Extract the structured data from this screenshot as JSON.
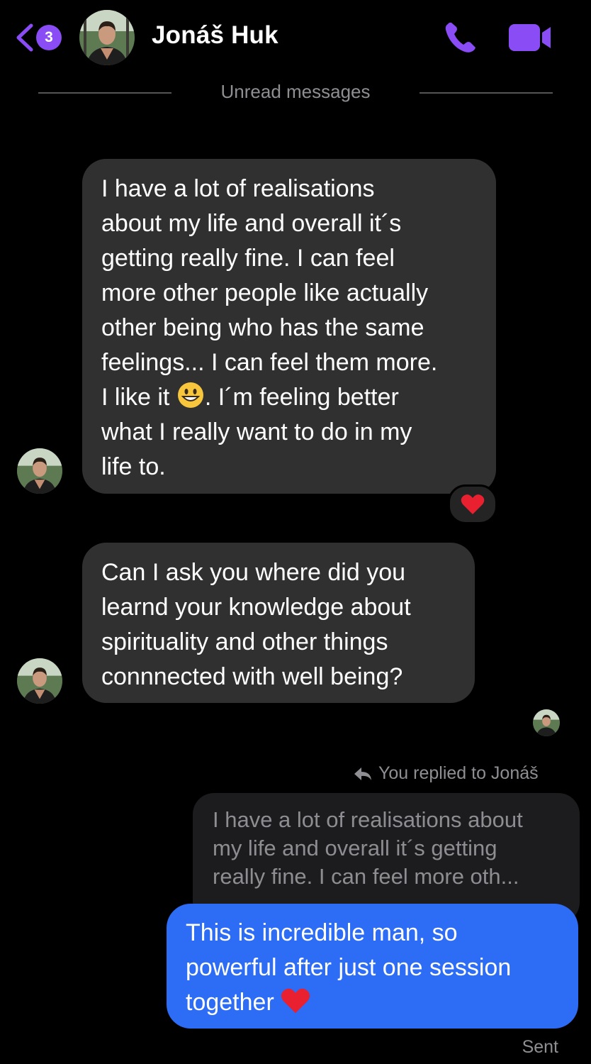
{
  "header": {
    "back_count": "3",
    "contact_name": "Jonáš Huk",
    "accent_color": "#8a4cf5"
  },
  "divider": {
    "label": "Unread messages"
  },
  "messages": {
    "first": {
      "text_before_emoji": "I have a lot of realisations\nabout my life and overall it´s\ngetting really fine. I can feel\nmore other people like actually\nother being who has the same\nfeelings... I can feel them more.\nI like it ",
      "text_after_emoji": ". I´m feeling better\nwhat I really want to do in my\nlife to.",
      "emoji": "grinning-face",
      "reaction": "red-heart"
    },
    "second": {
      "text": "Can I ask you where did you\nlearnd your knowledge about\nspirituality and other things\nconnnected with well being?"
    }
  },
  "reply": {
    "label": "You replied to Jonáš",
    "quoted_text": "I have a lot of realisations about\nmy life and overall it´s getting\nreally fine. I can feel more oth...",
    "sent_text": "This is incredible man, so\npowerful after just one session\ntogether ",
    "sent_emoji": "red-heart",
    "bubble_color": "#2d6cf5"
  },
  "status": {
    "sent_label": "Sent"
  }
}
